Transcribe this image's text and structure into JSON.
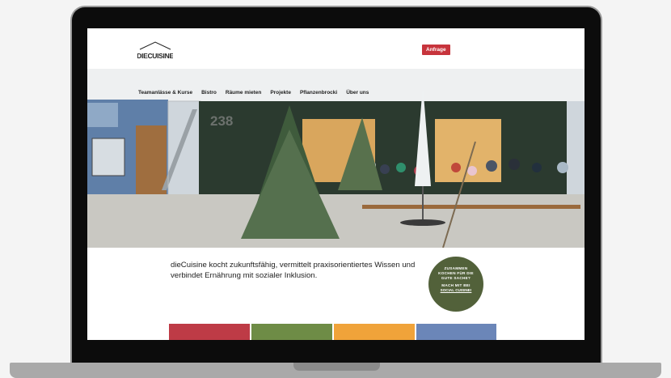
{
  "site": {
    "logo_text": "DIECUISINE",
    "cta_label": "Anfrage",
    "nav": [
      "Teamanlässe & Kurse",
      "Bistro",
      "Räume mieten",
      "Projekte",
      "Pflanzenbrocki",
      "Über uns"
    ],
    "hero": {
      "building_number": "238"
    },
    "tagline": "dieCuisine kocht zukunftsfähig, vermittelt praxisorientiertes Wissen und verbindet Ernährung mit sozialer Inklusion.",
    "badge": {
      "line1": "ZUSAMMEN KOCHEN FÜR DIE GUTE SACHE?",
      "line2": "MACH MIT BEI",
      "line3": "SOCIAL CUISINE!"
    },
    "tiles": [
      "#be3b46",
      "#6e8c46",
      "#f0a33a",
      "#6b86b8"
    ]
  },
  "colors": {
    "accent": "#c7343c",
    "badge": "#52613a"
  }
}
